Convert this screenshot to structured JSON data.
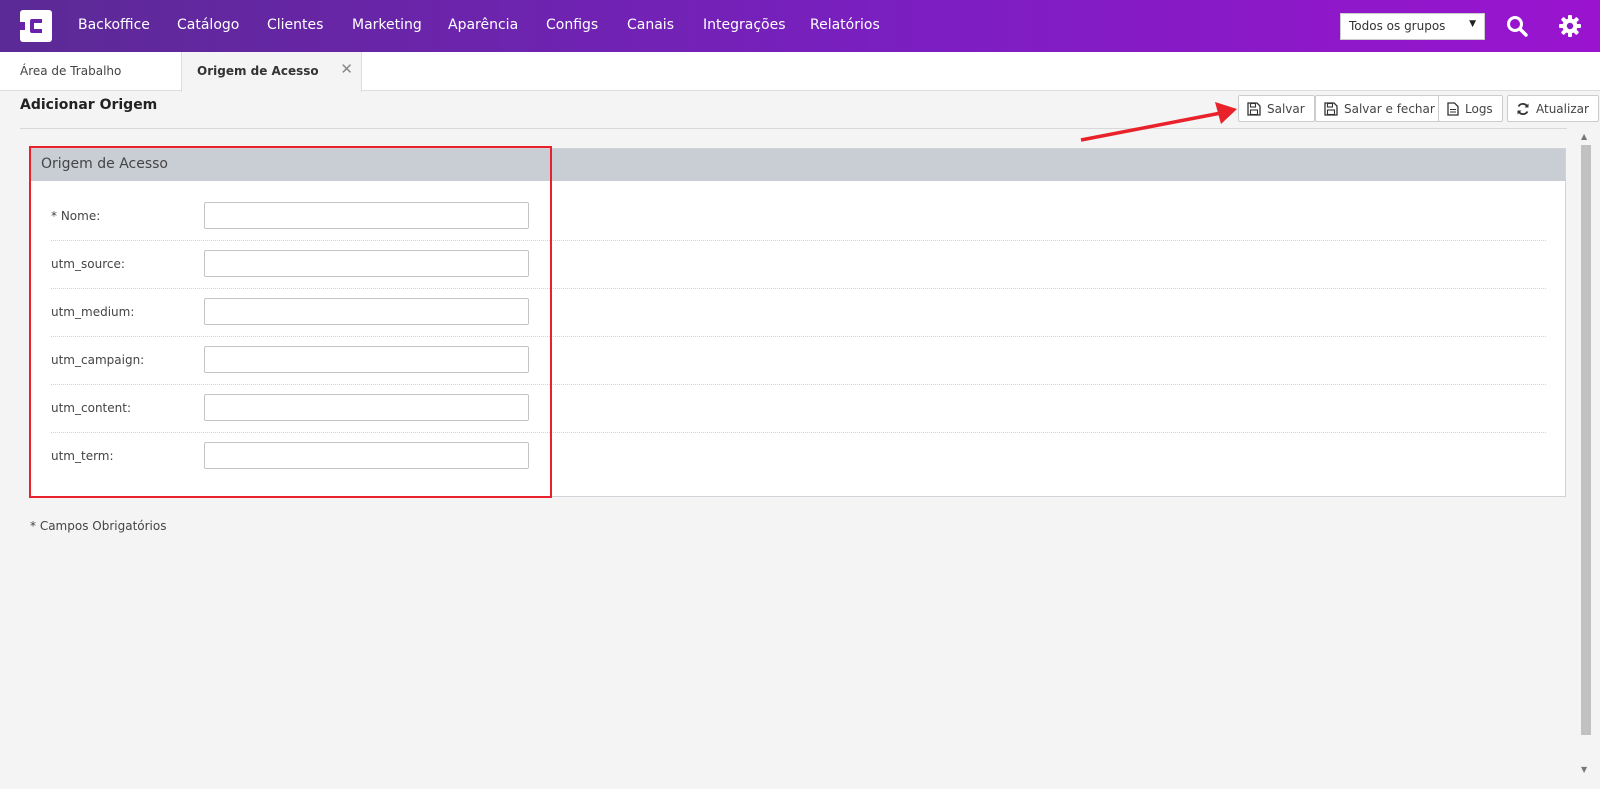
{
  "topbar": {
    "nav_items": [
      "Backoffice",
      "Catálogo",
      "Clientes",
      "Marketing",
      "Aparência",
      "Configs",
      "Canais",
      "Integrações",
      "Relatórios"
    ],
    "group_select_value": "Todos os grupos",
    "search_icon": "search-icon",
    "settings_icon": "gear-icon",
    "gradient": [
      "#5b2a95",
      "#9a14cf"
    ]
  },
  "tabs": [
    {
      "label": "Área de Trabalho"
    },
    {
      "label": "Origem de Acesso"
    }
  ],
  "page": {
    "title": "Adicionar Origem"
  },
  "toolbar": {
    "save_label": "Salvar",
    "save_close_label": "Salvar e fechar",
    "logs_label": "Logs",
    "refresh_label": "Atualizar"
  },
  "panel": {
    "title": "Origem de Acesso",
    "fields": [
      {
        "label": "* Nome:",
        "value": ""
      },
      {
        "label": "utm_source:",
        "value": ""
      },
      {
        "label": "utm_medium:",
        "value": ""
      },
      {
        "label": "utm_campaign:",
        "value": ""
      },
      {
        "label": "utm_content:",
        "value": ""
      },
      {
        "label": "utm_term:",
        "value": ""
      }
    ]
  },
  "footer": {
    "required_note": "* Campos Obrigatórios"
  },
  "annotation": {
    "color": "#e8212a"
  }
}
